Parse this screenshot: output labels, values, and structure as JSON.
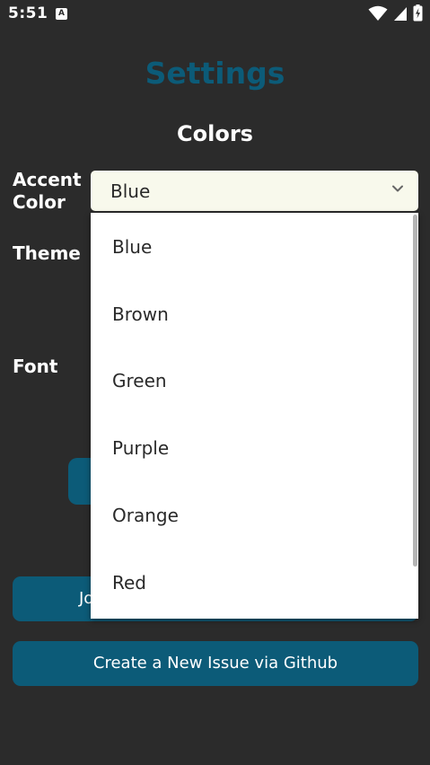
{
  "status_bar": {
    "time": "5:51",
    "app_icon_letter": "A",
    "icons": [
      "wifi-icon",
      "cell-signal-icon",
      "battery-charging-icon"
    ]
  },
  "page": {
    "title": "Settings",
    "section_title": "Colors"
  },
  "settings": {
    "accent_color": {
      "label": "Accent Color",
      "selected": "Blue"
    },
    "theme": {
      "label": "Theme"
    },
    "font": {
      "label": "Font"
    }
  },
  "dropdown": {
    "options": [
      "Blue",
      "Brown",
      "Green",
      "Purple",
      "Orange",
      "Red"
    ]
  },
  "buttons": {
    "join_partial": "Jo",
    "create_issue": "Create a New Issue via Github"
  },
  "colors": {
    "background": "#2b2b2b",
    "accent": "#0c5b78",
    "select_bg": "#f8f9ec",
    "dropdown_bg": "#ffffff"
  }
}
